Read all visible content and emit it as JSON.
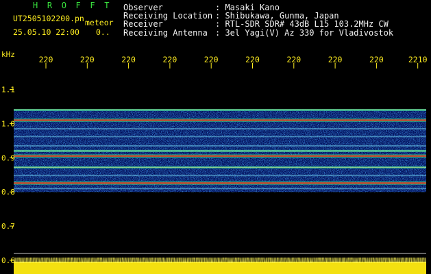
{
  "header": {
    "program": "H R O F F T",
    "filename": "UT2505102200.pn",
    "mode": "meteor",
    "datetime": "25.05.10 22:00",
    "status": "0..",
    "info": [
      {
        "label": "Observer",
        "value": ": Masaki Kano"
      },
      {
        "label": "Receiving Location",
        "value": ": Shibukawa, Gunma, Japan"
      },
      {
        "label": "Receiver",
        "value": ": RTL-SDR SDR# 43dB L15 103.2MHz CW"
      },
      {
        "label": "Receiving Antenna",
        "value": ": 3el Yagi(V) Az 330 for Vladivostok"
      }
    ]
  },
  "colors": {
    "text_yellow": "#ffee20",
    "text_green": "#39e23e",
    "text_white": "#f2f2f2",
    "spectrum_background": "#000a55",
    "strong_line": "#ff2a10"
  },
  "chart_data": {
    "type": "heatmap",
    "title": "",
    "ylabel": "kHz",
    "ylim": [
      0.6,
      1.2
    ],
    "yticks": [
      "1.1",
      "1.0",
      "0.9",
      "0.8",
      "0.7",
      "0.6"
    ],
    "yticks_values": [
      1.1,
      1.0,
      0.9,
      0.8,
      0.7,
      0.6
    ],
    "xticks": [
      "220",
      "220",
      "220",
      "220",
      "220",
      "220",
      "220",
      "220",
      "220",
      "2210"
    ],
    "xticks_values": [
      1,
      2,
      3,
      4,
      5,
      6,
      7,
      8,
      9,
      10
    ],
    "xlim": [
      0,
      10
    ],
    "noise_band_khz": [
      0.8,
      1.04
    ],
    "lines": [
      {
        "freq_khz": 1.04,
        "strength": "medium"
      },
      {
        "freq_khz": 1.01,
        "strength": "strong"
      },
      {
        "freq_khz": 0.985,
        "strength": "weak"
      },
      {
        "freq_khz": 0.962,
        "strength": "weak"
      },
      {
        "freq_khz": 0.935,
        "strength": "weak"
      },
      {
        "freq_khz": 0.92,
        "strength": "medium"
      },
      {
        "freq_khz": 0.905,
        "strength": "strong"
      },
      {
        "freq_khz": 0.872,
        "strength": "medium"
      },
      {
        "freq_khz": 0.848,
        "strength": "weak"
      },
      {
        "freq_khz": 0.826,
        "strength": "strong"
      },
      {
        "freq_khz": 0.81,
        "strength": "weak"
      }
    ],
    "bottom_signal": "continuous yellow noise level"
  }
}
